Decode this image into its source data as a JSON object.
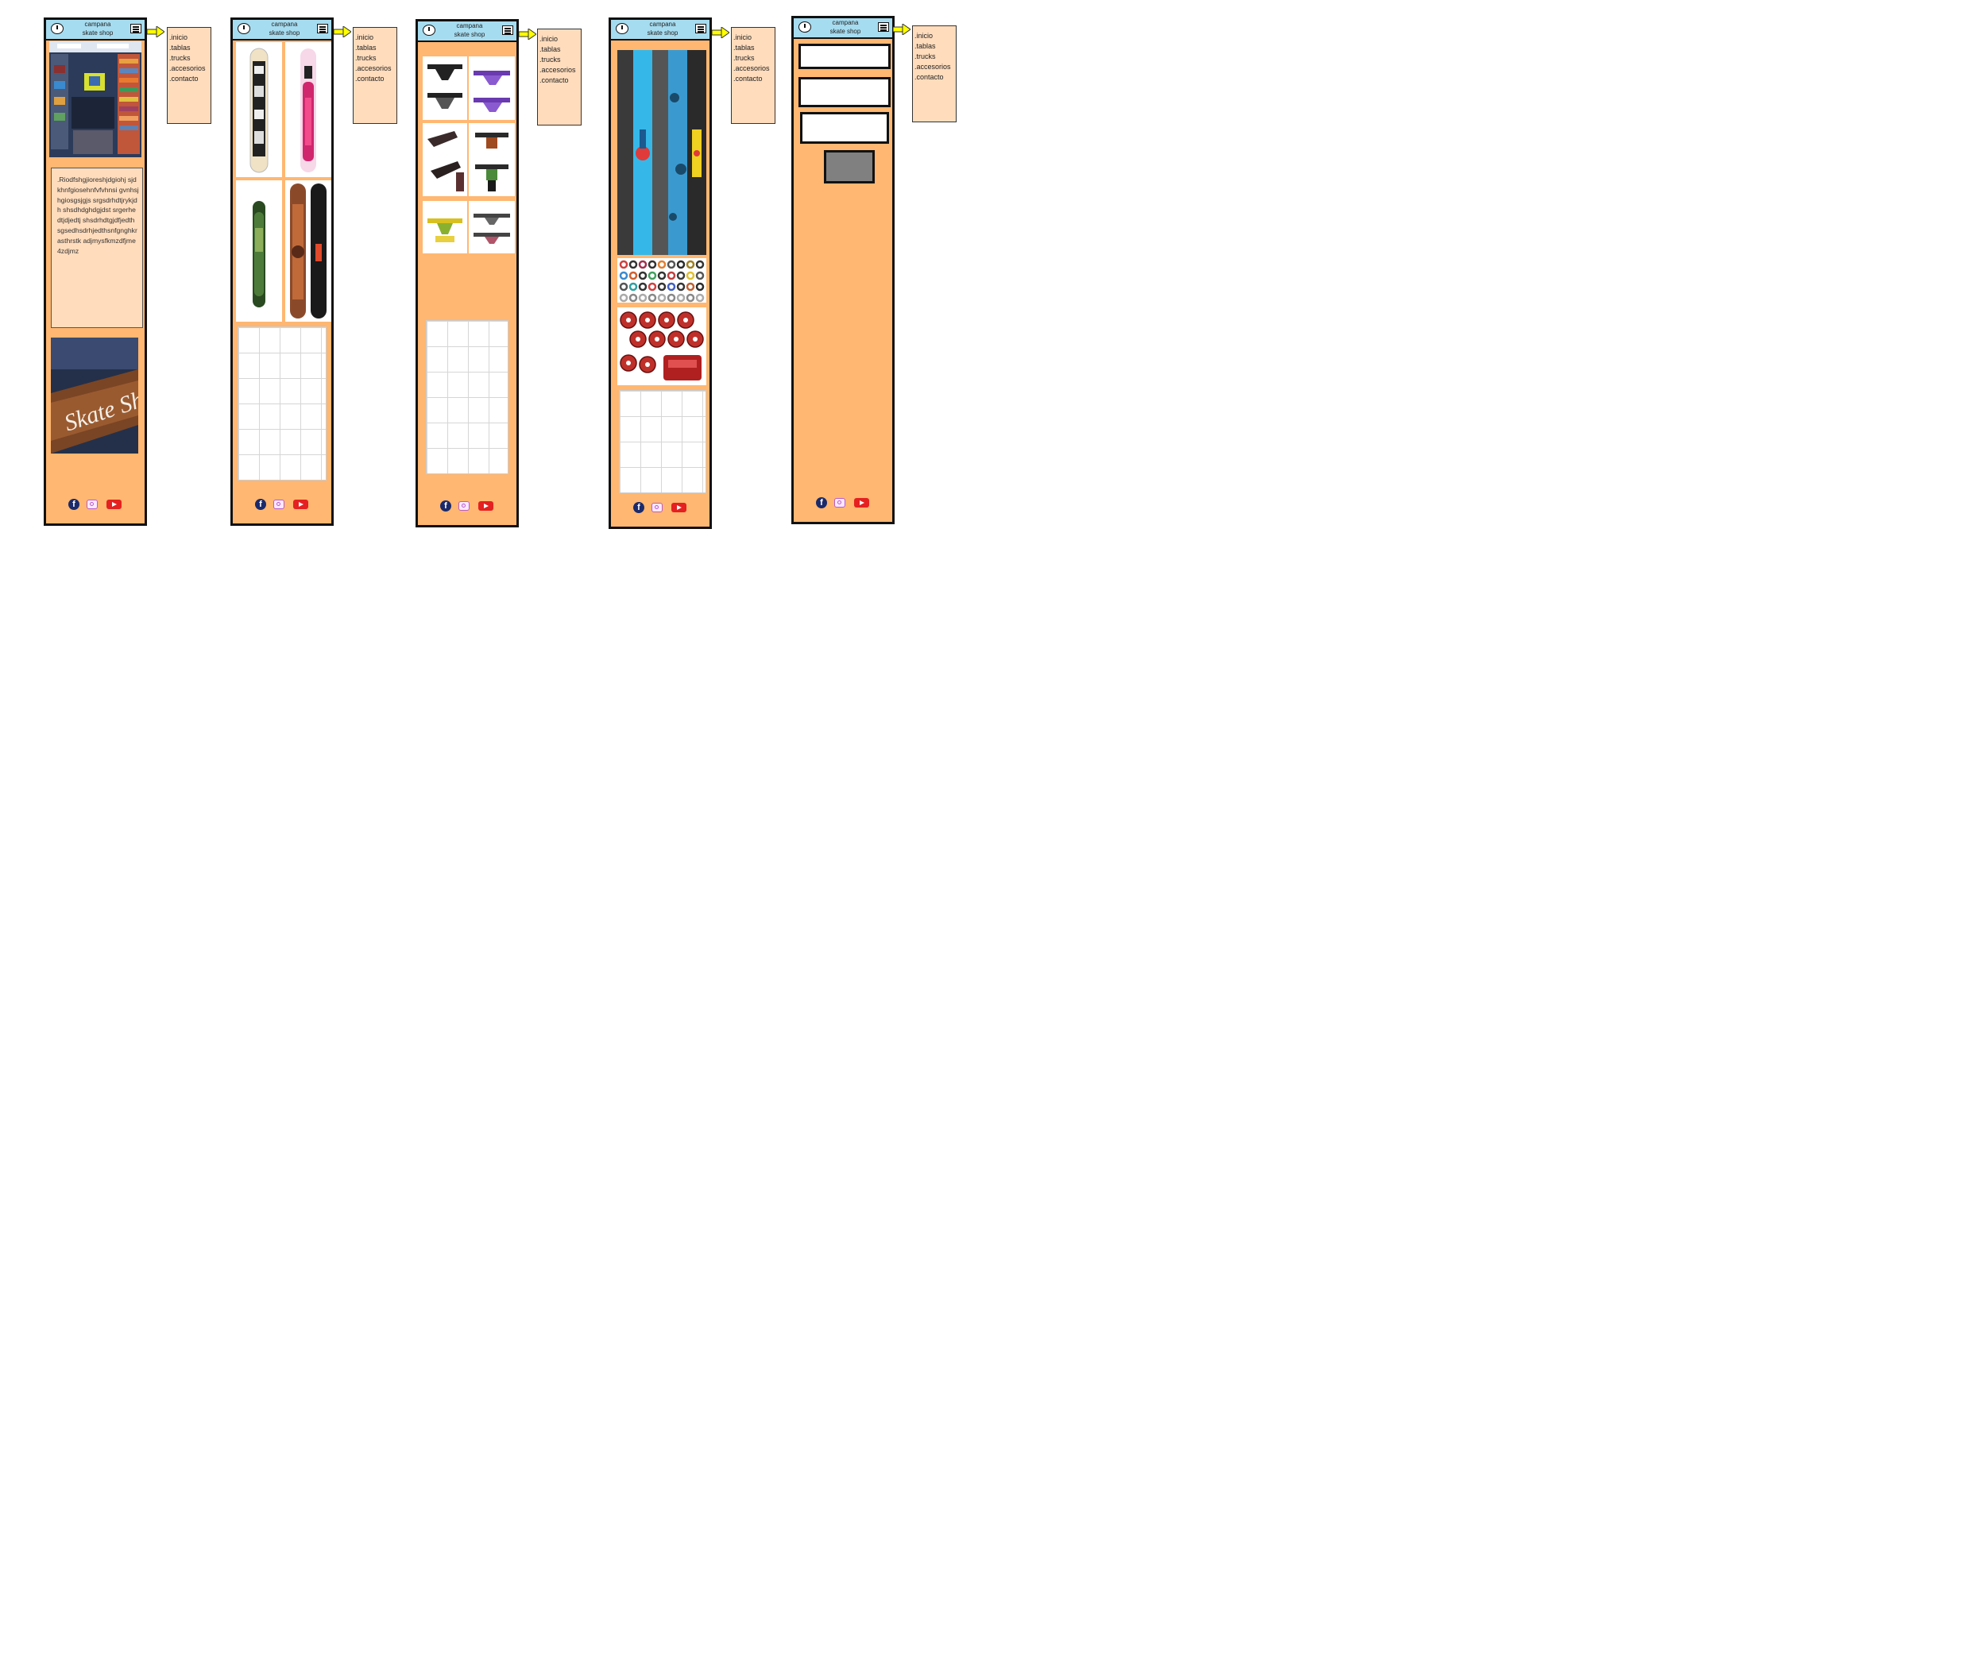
{
  "brand": {
    "line1": "campana",
    "line2": "skate shop"
  },
  "menu": {
    "items": [
      ".inicio",
      ".tablas",
      ".trucks",
      ".accesorios",
      ".contacto"
    ]
  },
  "home": {
    "text": ".Riodfshgjioreshjdgiohj sjdkhnfgiosehnfvfvhnsi gvnhsjhgiosgsjgjs srgsdrhdtjrykjdh shsdhdghdgjdst srgerhedtjdjedtj shsdrhdtgjdfjedth sgsedhsdrhjedthsnfgnghkrasthrstk adjmysfkmzdfjme4zdjmz"
  },
  "colors": {
    "page_bg": "#ffb771",
    "header_bg": "#a6dcf0",
    "menu_bg": "#ffdcbc",
    "arrow": "#ffff00",
    "submit": "#808080"
  },
  "icons": [
    "clock-logo-icon",
    "menu-icon",
    "facebook-icon",
    "instagram-icon",
    "youtube-icon"
  ]
}
